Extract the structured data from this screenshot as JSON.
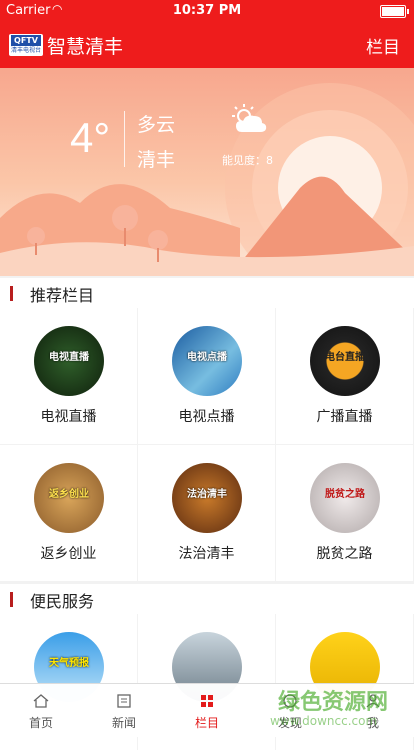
{
  "status_bar": {
    "carrier": "Carrier",
    "time": "10:37 PM"
  },
  "nav": {
    "logo_top": "QFTV",
    "logo_bottom": "清丰电视台",
    "title": "智慧清丰",
    "menu_label": "栏目"
  },
  "weather": {
    "temperature": "4°",
    "description": "多云",
    "city": "清丰",
    "visibility": "能见度：8"
  },
  "sections": [
    {
      "title": "推荐栏目",
      "items": [
        {
          "label": "电视直播",
          "thumb_text": "电视直播"
        },
        {
          "label": "电视点播",
          "thumb_text": "电视点播"
        },
        {
          "label": "广播直播",
          "thumb_text": "电台直播"
        },
        {
          "label": "返乡创业",
          "thumb_text": "返乡创业"
        },
        {
          "label": "法治清丰",
          "thumb_text": "法治清丰"
        },
        {
          "label": "脱贫之路",
          "thumb_text": "脱贫之路"
        }
      ]
    },
    {
      "title": "便民服务",
      "items": [
        {
          "label": "",
          "thumb_text": "天气预报"
        },
        {
          "label": "",
          "thumb_text": ""
        },
        {
          "label": "",
          "thumb_text": ""
        }
      ]
    }
  ],
  "tabs": [
    {
      "label": "首页",
      "icon": "home-icon"
    },
    {
      "label": "新闻",
      "icon": "news-icon"
    },
    {
      "label": "栏目",
      "icon": "grid-icon"
    },
    {
      "label": "发现",
      "icon": "discover-icon"
    },
    {
      "label": "我",
      "icon": "user-icon"
    }
  ],
  "watermark": {
    "name": "绿色资源网",
    "url": "www.downcc.com"
  },
  "colors": {
    "brand_red": "#ee1c1c",
    "accent_bar": "#b81e1e",
    "active_tab": "#e31b1b"
  }
}
